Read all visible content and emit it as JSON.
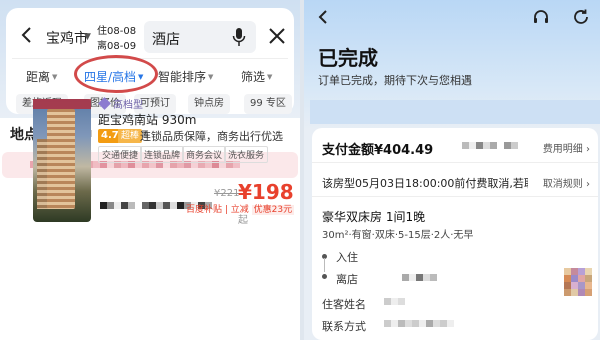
{
  "left": {
    "search": {
      "city": "宝鸡市",
      "checkin": "住08-08",
      "checkout": "离08-09",
      "query": "酒店"
    },
    "filters": [
      "距离",
      "四星/高档",
      "智能排序",
      "筛选"
    ],
    "active_filter_index": 1,
    "chips": [
      "差旅返现",
      "图好价",
      "可预订",
      "钟点房",
      "99 专区"
    ],
    "location_tab": "地点",
    "hotel": {
      "tier": "高档型",
      "distance": "距宝鸡南站 930m",
      "score": "4.7",
      "score_word": "超棒",
      "tagline": "连锁品质保障，商务出行优选",
      "tags": [
        "交通便捷",
        "连锁品牌",
        "商务会议",
        "洗衣服务"
      ],
      "original_price": "¥221",
      "price": "¥198",
      "price_suffix": "起",
      "discount_sources": "百度补贴 | 立减",
      "discount_badge": "优惠23元"
    }
  },
  "right": {
    "title": "已完成",
    "subtitle": "订单已完成，期待下次与您相遇",
    "payment_label": "支付金额¥404.49",
    "fee_detail": "费用明细",
    "cancel_text": "该房型05月03日18:00:00前付费取消,若取...",
    "cancel_rule": "取消规则",
    "room_name": "豪华双床房  1间1晚",
    "room_info": "30m²·有窗·双床·5-15层·2人·无早",
    "checkin_label": "入住",
    "checkout_label": "离店",
    "guest_name_label": "住客姓名",
    "contact_label": "联系方式"
  },
  "colors": {
    "accent": "#2776e6",
    "price_red": "#e8412d",
    "highlight_circle": "#d24a4a",
    "score_orange": "#f39c12"
  },
  "icons": [
    "back-arrow-icon",
    "microphone-icon",
    "close-icon",
    "headset-icon",
    "refresh-icon",
    "diamond-icon",
    "chevron-right-icon"
  ]
}
